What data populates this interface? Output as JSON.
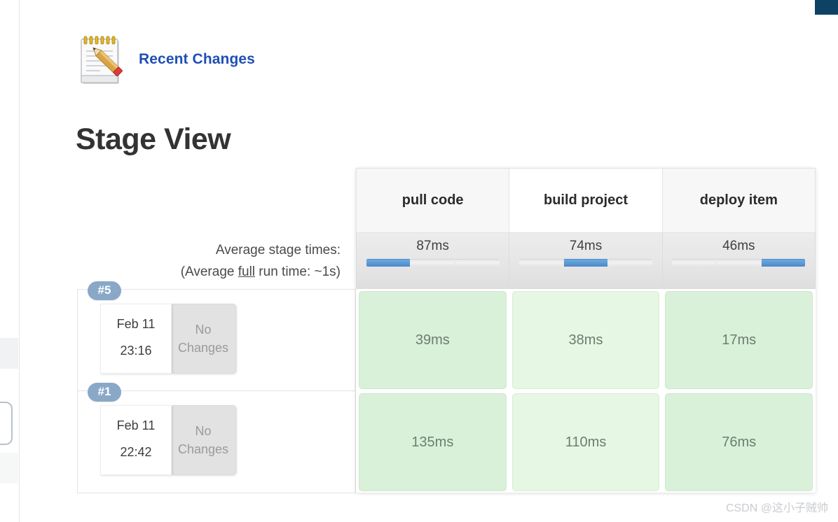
{
  "chrome": {
    "top_right_block_color": "#0d4265"
  },
  "recent_changes": {
    "label": "Recent Changes",
    "icon": "notepad-pencil-icon",
    "link_color": "#1f4fb5"
  },
  "page_title": "Stage View",
  "averages": {
    "label_line1": "Average stage times:",
    "label_line2_prefix": "(Average ",
    "label_line2_underlined": "full",
    "label_line2_suffix": " run time: ~1s)"
  },
  "watermark": "CSDN @这小子贼帅",
  "chart_data": {
    "type": "table",
    "title": "Stage View",
    "categories": [
      "pull code",
      "build project",
      "deploy item"
    ],
    "average_values": [
      "87ms",
      "74ms",
      "46ms"
    ],
    "average_numeric": [
      87,
      74,
      46
    ],
    "average_full_run_time": "~1s",
    "progress_segments": [
      [
        true,
        false,
        false
      ],
      [
        false,
        true,
        false
      ],
      [
        false,
        false,
        true
      ]
    ],
    "rows": [
      {
        "build": "#5",
        "date": "Feb 11",
        "time": "23:16",
        "changes": "No Changes",
        "values": [
          "39ms",
          "38ms",
          "17ms"
        ],
        "numeric": [
          39,
          38,
          17
        ]
      },
      {
        "build": "#1",
        "date": "Feb 11",
        "time": "22:42",
        "changes": "No Changes",
        "values": [
          "135ms",
          "110ms",
          "76ms"
        ],
        "numeric": [
          135,
          110,
          76
        ]
      }
    ],
    "colors": {
      "stage_cell": "#d9f0d9",
      "stage_cell_hover": "#e6f7e3",
      "progress_active": "#5b9bd5",
      "badge": "#89a8c7"
    }
  }
}
